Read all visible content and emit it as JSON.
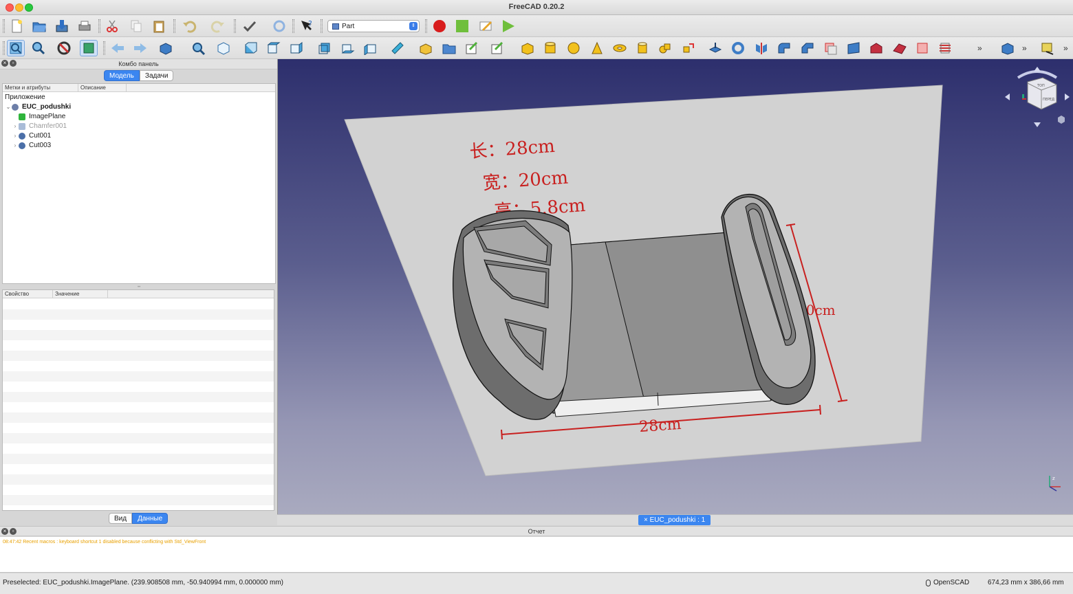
{
  "window": {
    "title": "FreeCAD 0.20.2"
  },
  "workbench": {
    "selected": "Part"
  },
  "combo_panel": {
    "title": "Комбо панель",
    "tabs": [
      {
        "label": "Модель"
      },
      {
        "label": "Задачи"
      }
    ],
    "tree": {
      "columns": [
        "Метки и атрибуты",
        "Описание"
      ],
      "root_label": "Приложение",
      "items": [
        {
          "label": "EUC_podushki",
          "bold": true,
          "expanded": true
        },
        {
          "label": "ImagePlane"
        },
        {
          "label": "Chamfer001",
          "dimmed": true
        },
        {
          "label": "Cut001"
        },
        {
          "label": "Cut003"
        }
      ]
    },
    "properties": {
      "columns": [
        "Свойство",
        "Значение"
      ]
    },
    "bottom_tabs": [
      {
        "label": "Вид"
      },
      {
        "label": "Данные"
      }
    ]
  },
  "viewport": {
    "image_text": {
      "length": "长：28cm",
      "width": "宽：20cm",
      "height": "高：5.8cm",
      "dim_bottom": "28cm",
      "dim_right": "20cm"
    },
    "navcube": {
      "top_label": "ТОП",
      "front_label": "ПЕРЕД"
    }
  },
  "document_tab": {
    "label": "EUC_podushki : 1",
    "close_icon": "×"
  },
  "report": {
    "title": "Отчет",
    "lines": [
      "08:47:42  Recent macros : keyboard shortcut 1 disabled because conflicting with Std_ViewFront"
    ]
  },
  "status": {
    "message": "Preselected: EUC_podushki.ImagePlane. (239.908508 mm, -50.940994 mm, 0.000000 mm)",
    "navigation": "OpenSCAD",
    "dimensions": "674,23 mm x 386,66 mm"
  },
  "colors": {
    "accent": "#3b86f0",
    "record": "#d81c1c",
    "stop": "#6fbf3c"
  }
}
